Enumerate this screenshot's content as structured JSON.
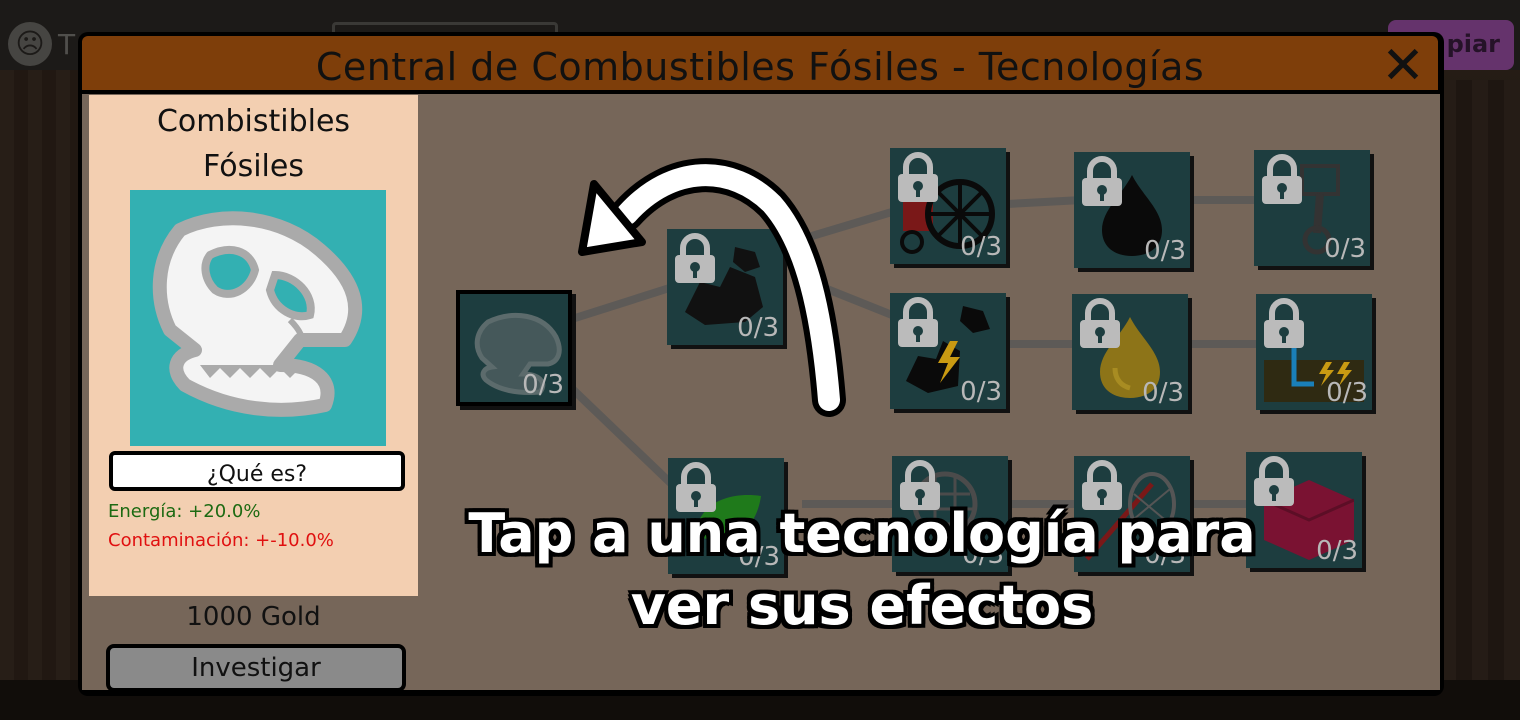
{
  "background": {
    "avatar_glyph": "☹",
    "avatar_letter": "T",
    "copy_button": "piar"
  },
  "modal": {
    "title": "Central de Combustibles Fósiles - Tecnologías",
    "close_glyph": "✕"
  },
  "info": {
    "name": "Combistibles Fósiles",
    "what_is_label": "¿Qué es?",
    "energy_effect": "Energía: +20.0%",
    "pollution_effect": "Contaminación: +-10.0%",
    "cost": "1000 Gold",
    "research_label": "Investigar"
  },
  "tree": {
    "nodes": [
      {
        "id": "fossil-fuels",
        "icon": "dinosaur-skull-icon",
        "progress": "0/3",
        "locked": false,
        "selected": true
      },
      {
        "id": "coal",
        "icon": "coal-icon",
        "progress": "0/3",
        "locked": true
      },
      {
        "id": "wheel",
        "icon": "wheel-icon",
        "progress": "0/3",
        "locked": true
      },
      {
        "id": "oil-drop",
        "icon": "oil-drop-icon",
        "progress": "0/3",
        "locked": true
      },
      {
        "id": "piston",
        "icon": "piston-icon",
        "progress": "0/3",
        "locked": true
      },
      {
        "id": "coal-power",
        "icon": "coal-power-icon",
        "progress": "0/3",
        "locked": true
      },
      {
        "id": "gas-drop",
        "icon": "gas-drop-icon",
        "progress": "0/3",
        "locked": true
      },
      {
        "id": "underground-power",
        "icon": "underground-power-icon",
        "progress": "0/3",
        "locked": true
      },
      {
        "id": "green-tech",
        "icon": "leaf-icon",
        "progress": "0/3",
        "locked": true
      },
      {
        "id": "filter",
        "icon": "filter-icon",
        "progress": "0/3",
        "locked": true
      },
      {
        "id": "net",
        "icon": "net-icon",
        "progress": "0/3",
        "locked": true
      },
      {
        "id": "block",
        "icon": "block-icon",
        "progress": "0/3",
        "locked": true
      }
    ]
  },
  "tutorial": {
    "hint": "Tap a una tecnología para ver sus efectos"
  },
  "colors": {
    "header": "#7e3e0a",
    "panel": "#f3cfb1",
    "tree_bg": "#766659",
    "node_bg": "#1d3d3f",
    "energy": "#1d6a12",
    "pollution": "#e01010"
  }
}
